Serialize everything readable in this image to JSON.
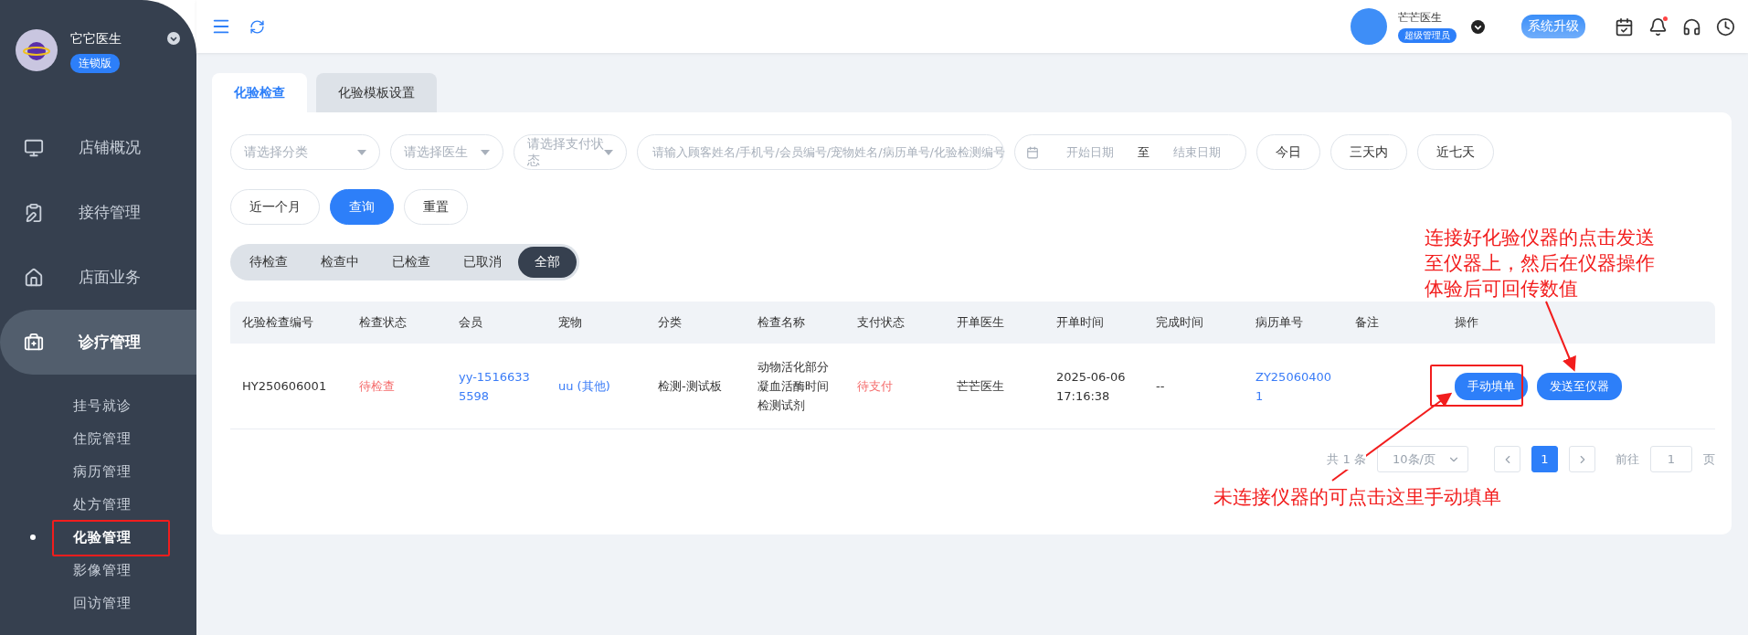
{
  "sidebar": {
    "brand": {
      "name": "它它医生",
      "edition": "连锁版"
    },
    "nav": [
      {
        "label": "店铺概况",
        "selected": false,
        "expanded": false
      },
      {
        "label": "接待管理",
        "selected": false,
        "expanded": false
      },
      {
        "label": "店面业务",
        "selected": false,
        "expanded": false
      },
      {
        "label": "诊疗管理",
        "selected": true,
        "expanded": true,
        "children": [
          {
            "label": "挂号就诊",
            "selected": false
          },
          {
            "label": "住院管理",
            "selected": false
          },
          {
            "label": "病历管理",
            "selected": false
          },
          {
            "label": "处方管理",
            "selected": false
          },
          {
            "label": "化验管理",
            "selected": true
          },
          {
            "label": "影像管理",
            "selected": false
          },
          {
            "label": "回访管理",
            "selected": false
          }
        ]
      }
    ]
  },
  "topbar": {
    "user": {
      "name": "芒芒医生",
      "role": "超级管理员"
    },
    "upgrade": "系统升级",
    "unread": true
  },
  "tabs": [
    {
      "label": "化验检查",
      "selected": true
    },
    {
      "label": "化验模板设置",
      "selected": false
    }
  ],
  "filters": {
    "selects": [
      "请选择分类",
      "请选择医生",
      "请选择支付状态"
    ],
    "search": {
      "placeholder": "请输入顾客姓名/手机号/会员编号/宠物姓名/病历单号/化验检测编号"
    },
    "date_range": {
      "start_placeholder": "开始日期",
      "separator": "至",
      "end_placeholder": "结束日期"
    },
    "buttons": [
      {
        "label": "今日",
        "kind": "default"
      },
      {
        "label": "三天内",
        "kind": "default"
      },
      {
        "label": "近七天",
        "kind": "default"
      },
      {
        "label": "近一个月",
        "kind": "default"
      },
      {
        "label": "查询",
        "kind": "primary"
      },
      {
        "label": "重置",
        "kind": "default"
      }
    ]
  },
  "status_filter": [
    {
      "label": "待检查",
      "selected": false
    },
    {
      "label": "检查中",
      "selected": false
    },
    {
      "label": "已检查",
      "selected": false
    },
    {
      "label": "已取消",
      "selected": false
    },
    {
      "label": "全部",
      "selected": true
    }
  ],
  "table": {
    "columns": [
      {
        "label": "化验检查编号",
        "kind": "text"
      },
      {
        "label": "检查状态",
        "kind": "danger"
      },
      {
        "label": "会员",
        "kind": "link"
      },
      {
        "label": "宠物",
        "kind": "link"
      },
      {
        "label": "分类",
        "kind": "text"
      },
      {
        "label": "检查名称",
        "kind": "text"
      },
      {
        "label": "支付状态",
        "kind": "danger"
      },
      {
        "label": "开单医生",
        "kind": "text"
      },
      {
        "label": "开单时间",
        "kind": "text"
      },
      {
        "label": "完成时间",
        "kind": "text"
      },
      {
        "label": "病历单号",
        "kind": "link"
      },
      {
        "label": "备注",
        "kind": "text"
      },
      {
        "label": "操作",
        "kind": "actions"
      }
    ],
    "rows": [
      {
        "cells": [
          "HY250606001",
          "待检查",
          "yy-15166335598",
          "uu (其他)",
          "检测-测试板",
          "动物活化部分凝血活酶时间检测试剂",
          "待支付",
          "芒芒医生",
          "2025-06-06 17:16:38",
          "--",
          "ZY250604001",
          "",
          ""
        ],
        "actions": [
          "手动填单",
          "发送至仪器"
        ]
      }
    ]
  },
  "pagination": {
    "total": "共 1 条",
    "page_size": "10条/页",
    "pages": [
      {
        "label": "1",
        "selected": true
      }
    ],
    "goto_label": "前往",
    "goto_value": "1",
    "unit": "页"
  },
  "annotations": [
    {
      "text": "连接好化验仪器的点击发送至仪器上，然后在仪器操作体验后可回传数值"
    },
    {
      "text": "未连接仪器的可点击这里手动填单"
    }
  ]
}
